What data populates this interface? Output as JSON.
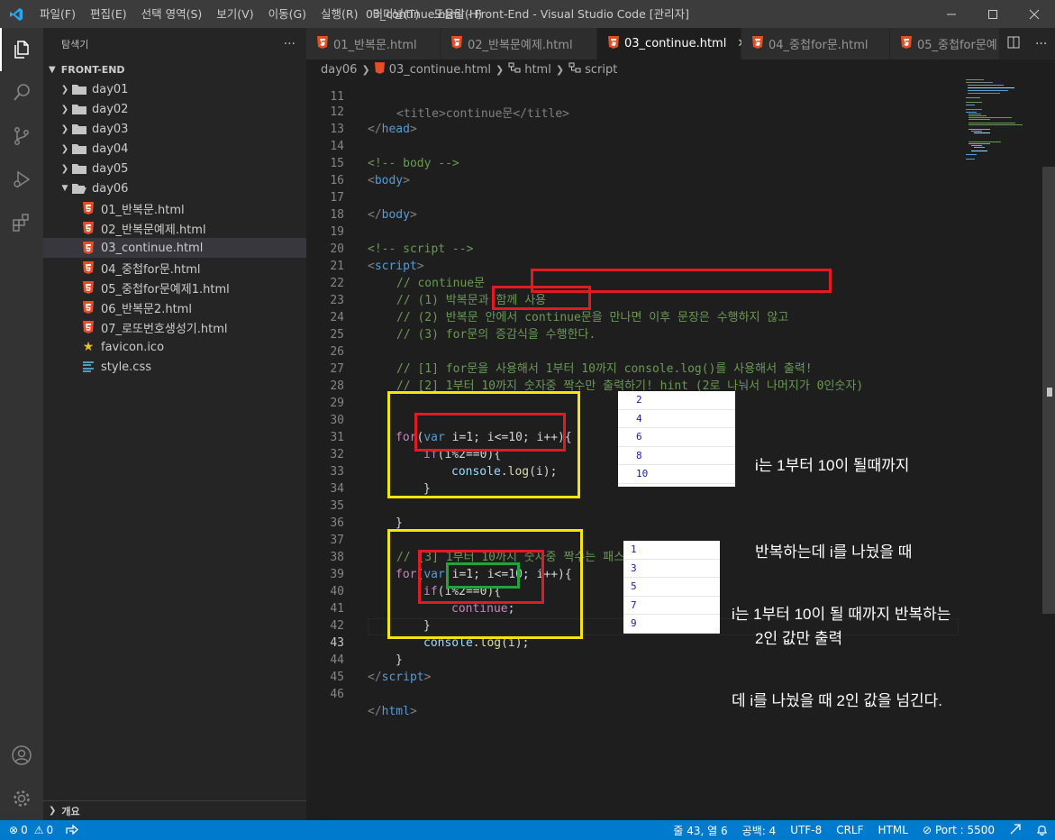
{
  "window": {
    "title": "03_continue.html - Front-End - Visual Studio Code [관리자]",
    "menu": [
      "파일(F)",
      "편집(E)",
      "선택 영역(S)",
      "보기(V)",
      "이동(G)",
      "실행(R)",
      "터미널(T)",
      "도움말(H)"
    ]
  },
  "sidebar": {
    "title": "탐색기",
    "more": "···",
    "root": "FRONT-END",
    "folders": [
      "day01",
      "day02",
      "day03",
      "day04",
      "day05"
    ],
    "open_folder": "day06",
    "files": [
      "01_반복문.html",
      "02_반복문예제.html",
      "03_continue.html",
      "04_중첩for문.html",
      "05_중첩for문예제1.html",
      "06_반복문2.html",
      "07_로또번호생성기.html"
    ],
    "root_files": [
      "favicon.ico",
      "style.css"
    ],
    "outline": "개요"
  },
  "tabs": [
    {
      "label": "01_반복문.html",
      "active": false
    },
    {
      "label": "02_반복문예제.html",
      "active": false
    },
    {
      "label": "03_continue.html",
      "active": true
    },
    {
      "label": "04_중첩for문.html",
      "active": false
    },
    {
      "label": "05_중첩for문예",
      "active": false
    }
  ],
  "breadcrumbs": [
    "day06",
    "03_continue.html",
    "html",
    "script"
  ],
  "editor": {
    "line_numbers": [
      "11",
      "12",
      "13",
      "14",
      "15",
      "16",
      "17",
      "18",
      "19",
      "20",
      "21",
      "22",
      "23",
      "24",
      "25",
      "26",
      "27",
      "28",
      "29",
      "30",
      "31",
      "32",
      "33",
      "34",
      "35",
      "36",
      "37",
      "38",
      "39",
      "40",
      "41",
      "42",
      "43",
      "44",
      "45",
      "46"
    ],
    "current_line": "43",
    "code": {
      "l11": "<title>continue문</title>",
      "l12_close_head": "head",
      "l14": "<!-- body -->",
      "l15_body": "body",
      "l17_body_close": "body",
      "l19": "<!-- script -->",
      "l20_script": "script",
      "l21": "// continue문",
      "l22": "// (1) 박복문과 함께 사용",
      "l23": "// (2) 반복문 안에서 continue문을 만나면 이후 문장은 수행하지 않고",
      "l24": "// (3) for문의 증감식을 수행한다.",
      "l26": "// [1] for문을 사용해서 1부터 10까지 console.log()를 사용해서 출력!",
      "l27": "// [2] 1부터 10까지 숫자중 짝수만 출력하기! hint (2로 나눠서 나머지가 0인숫자)",
      "l37": "// [3] 1부터 10까지 숫자중 짝수는 패스하기!",
      "l44_script_close": "script",
      "l46_html_close": "html",
      "kw_for": "for",
      "kw_var": "var",
      "kw_if": "if",
      "kw_continue": "continue",
      "for_head": " i=1; i<=10; i++){",
      "if_cond": "(i%2==0){",
      "console": "console",
      "log": "log",
      "log_arg": "(i);",
      "close_brace": "}"
    }
  },
  "output1": [
    "2",
    "4",
    "6",
    "8",
    "10"
  ],
  "output2": [
    "1",
    "3",
    "5",
    "7",
    "9"
  ],
  "note1": [
    "i는 1부터 10이 될때까지",
    "반복하는데 i를 나눴을 때",
    "2인 값만 출력"
  ],
  "note2": [
    "i는 1부터 10이 될 때까지 반복하는",
    "데 i를 나눴을 때 2인 값을 넘긴다."
  ],
  "status": {
    "errors": "0",
    "warnings": "0",
    "position": "줄 43, 열 6",
    "spaces": "공백: 4",
    "encoding": "UTF-8",
    "eol": "CRLF",
    "language": "HTML",
    "port": "Port : 5500"
  },
  "colors": {
    "accent": "#007acc",
    "box_red": "#e01b24",
    "box_yellow": "#f5e50c",
    "box_green": "#1fa539"
  }
}
